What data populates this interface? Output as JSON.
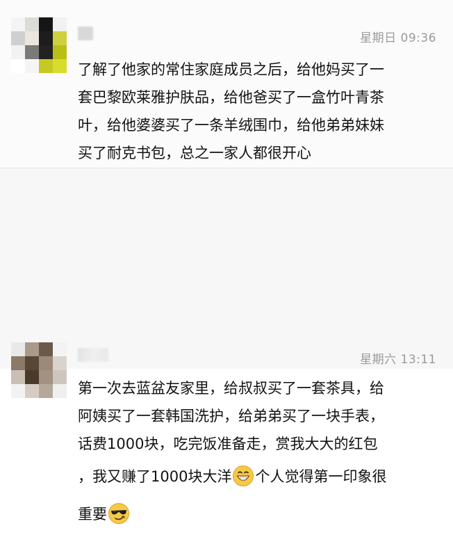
{
  "comments": [
    {
      "timestamp": "星期日 09:36",
      "lines": [
        "了解了他家的常住家庭成员之后，给他妈买了一",
        "套巴黎欧莱雅护肤品，给他爸买了一盒竹叶青茶",
        "叶，给他婆婆买了一条羊绒围巾，给他弟弟妹妹",
        "买了耐克书包，总之一家人都很开心"
      ]
    },
    {
      "timestamp": "星期六 13:11",
      "lines": [
        "第一次去蓝盆友家里，给叔叔买了一套茶具，给",
        "阿姨买了一套韩国洗护，给弟弟买了一块手表，",
        "话费1000块，吃完饭准备走，赏我大大的红包"
      ],
      "line4_before": "，我又赚了1000块大洋",
      "line4_after": "个人觉得第一印象很",
      "line5": "重要",
      "emoji1": "grinning-face-emoji",
      "emoji2": "cool-sunglasses-face-emoji"
    }
  ]
}
